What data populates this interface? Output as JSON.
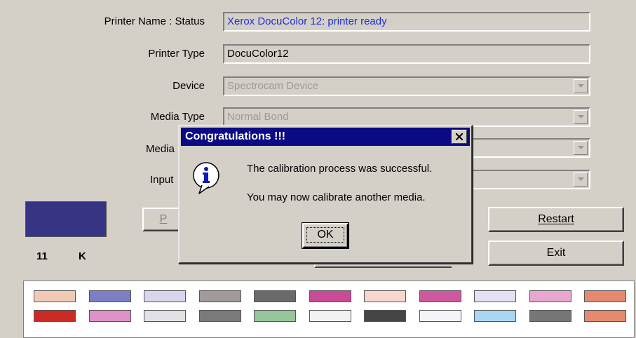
{
  "form": {
    "printer_name_label": "Printer Name : Status",
    "printer_name_value": "Xerox DocuColor 12: printer ready",
    "printer_type_label": "Printer Type",
    "printer_type_value": "DocuColor12",
    "device_label": "Device",
    "device_value": "Spectrocam Device",
    "media_type_label": "Media Type",
    "media_type_value": "Normal Bond",
    "media_label_partial": "Media",
    "input_label_partial": "Input"
  },
  "indicator": {
    "number": "11",
    "letter": "K",
    "color": "#363483"
  },
  "buttons": {
    "partial_label": "P",
    "restart_label": "Restart",
    "exit_label": "Exit"
  },
  "dialog": {
    "title": "Congratulations !!!",
    "message1": "The calibration process was successful.",
    "message2": "You may now calibrate another media.",
    "ok_label": "OK",
    "icon": "info-icon"
  },
  "swatches": {
    "row1": [
      "#f2c9b4",
      "#7c7fc6",
      "#d8d6ee",
      "#a09a99",
      "#6a6a6a",
      "#c94a96",
      "#f6d6cf",
      "#d0589f",
      "#e2e2f2",
      "#e9a6cf",
      "#e58a6e"
    ],
    "row2": [
      "#c92b24",
      "#e092c8",
      "#e2e2e6",
      "#7a7a7a",
      "#96c69c",
      "#f2f2f2",
      "#454545",
      "#f4f4f8",
      "#a9d6f2",
      "#777777",
      "#e58a6e"
    ]
  }
}
